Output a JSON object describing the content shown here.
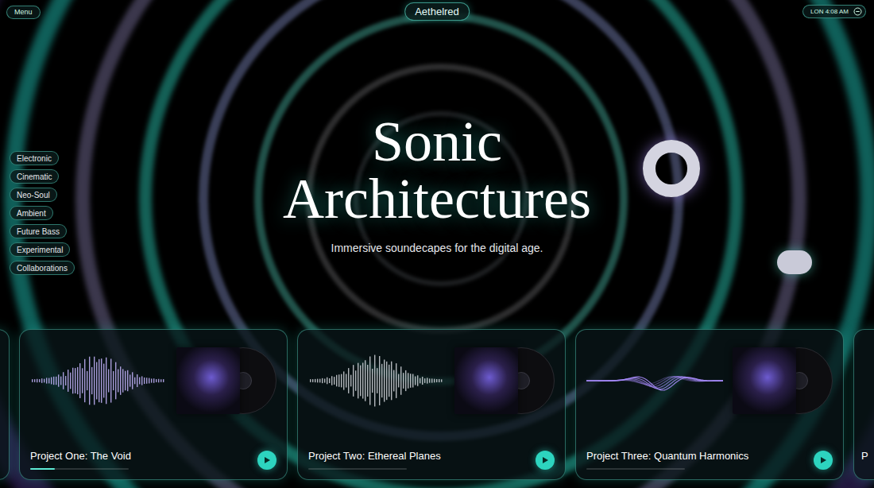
{
  "header": {
    "menu": "Menu",
    "brand": "Aethelred",
    "clock": "LON 4:08 AM"
  },
  "genres": [
    {
      "label": "Electronic"
    },
    {
      "label": "Cinematic"
    },
    {
      "label": "Neo-Soul"
    },
    {
      "label": "Ambient"
    },
    {
      "label": "Future Bass"
    },
    {
      "label": "Experimental"
    },
    {
      "label": "Collaborations"
    }
  ],
  "hero": {
    "title_line1": "Sonic",
    "title_line2": "Architectures",
    "subtitle": "Immersive soundecapes for the digital age."
  },
  "projects": [
    {
      "title": "Project One: The Void",
      "kind": "bars",
      "level": 0.25
    },
    {
      "title": "Project Two: Ethereal Planes",
      "kind": "bars",
      "level": 0.0
    },
    {
      "title": "Project Three: Quantum Harmonics",
      "kind": "curve",
      "level": 0.0
    }
  ],
  "peek": {
    "title": "P"
  }
}
